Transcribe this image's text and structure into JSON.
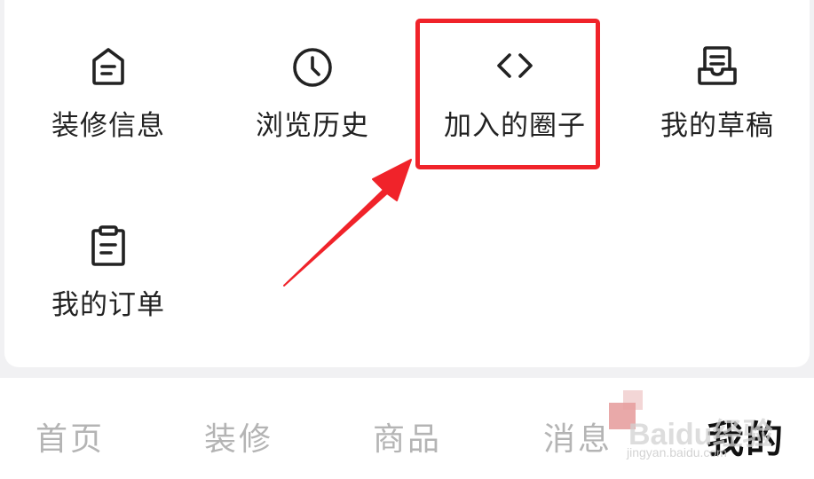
{
  "menu": {
    "items": [
      {
        "label": "装修信息",
        "icon": "document-icon"
      },
      {
        "label": "浏览历史",
        "icon": "clock-icon"
      },
      {
        "label": "加入的圈子",
        "icon": "code-icon"
      },
      {
        "label": "我的草稿",
        "icon": "inbox-icon"
      },
      {
        "label": "我的订单",
        "icon": "clipboard-icon"
      }
    ],
    "highlighted_item": "加入的圈子"
  },
  "tabbar": {
    "tabs": [
      {
        "label": "首页",
        "active": false
      },
      {
        "label": "装修",
        "active": false
      },
      {
        "label": "商品",
        "active": false
      },
      {
        "label": "消息",
        "active": false
      },
      {
        "label": "我的",
        "active": true
      }
    ]
  },
  "watermark": {
    "brand": "Baidu经验",
    "url": "jingyan.baidu.com"
  },
  "colors": {
    "highlight": "#f0232a",
    "tab_inactive": "#b4b4b4",
    "tab_active": "#111111",
    "card_bg": "#ffffff",
    "page_bg": "#f1f1f3"
  }
}
